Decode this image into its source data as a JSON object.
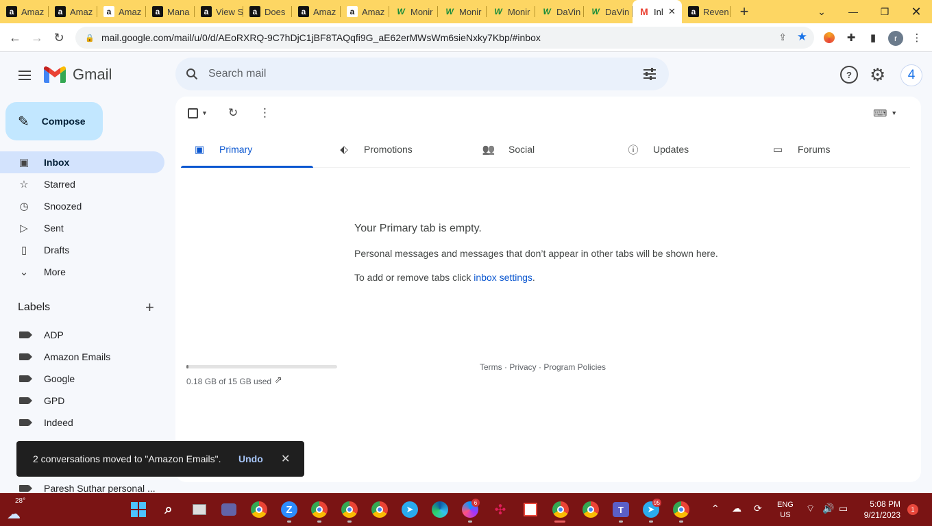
{
  "browser": {
    "tabs": [
      {
        "title": "Amaz",
        "icon": "amazon-icon"
      },
      {
        "title": "Amaz",
        "icon": "amazon-icon"
      },
      {
        "title": "Amaz",
        "icon": "amazon-icon"
      },
      {
        "title": "Mana",
        "icon": "amazon-icon"
      },
      {
        "title": "View S",
        "icon": "amazon-icon"
      },
      {
        "title": "Does",
        "icon": "amazon-icon"
      },
      {
        "title": "Amaz",
        "icon": "amazon-icon"
      },
      {
        "title": "Amaz",
        "icon": "amazon-icon"
      },
      {
        "title": "Monir",
        "icon": "monir-icon"
      },
      {
        "title": "Monir",
        "icon": "monir-icon"
      },
      {
        "title": "Monir",
        "icon": "monir-icon"
      },
      {
        "title": "DaVin",
        "icon": "davinci-icon"
      },
      {
        "title": "DaVin",
        "icon": "davinci-icon"
      },
      {
        "title": "Inl",
        "icon": "gmail-icon"
      },
      {
        "title": "Reven",
        "icon": "amazon-icon"
      }
    ],
    "url": "mail.google.com/mail/u/0/d/AEoRXRQ-9C7hDjC1jBF8TAQqfi9G_aE62erMWsWm6sieNxky7Kbp/#inbox",
    "profile_initial": "r"
  },
  "gmail": {
    "brand": "Gmail",
    "search_placeholder": "Search mail",
    "account_initial": "4",
    "compose_label": "Compose",
    "nav": [
      {
        "label": "Inbox",
        "icon": "inbox-icon"
      },
      {
        "label": "Starred",
        "icon": "star-icon"
      },
      {
        "label": "Snoozed",
        "icon": "clock-icon"
      },
      {
        "label": "Sent",
        "icon": "send-icon"
      },
      {
        "label": "Drafts",
        "icon": "draft-icon"
      },
      {
        "label": "More",
        "icon": "chevron-down-icon"
      }
    ],
    "labels_title": "Labels",
    "labels": [
      "ADP",
      "Amazon Emails",
      "Google",
      "GPD",
      "Indeed",
      "Paresh Suthar personal ..."
    ],
    "category_tabs": [
      {
        "label": "Primary",
        "icon": "inbox-icon"
      },
      {
        "label": "Promotions",
        "icon": "tag-icon"
      },
      {
        "label": "Social",
        "icon": "people-icon"
      },
      {
        "label": "Updates",
        "icon": "info-icon"
      },
      {
        "label": "Forums",
        "icon": "forum-icon"
      }
    ],
    "empty_title": "Your Primary tab is empty.",
    "empty_sub": "Personal messages and messages that don’t appear in other tabs will be shown here.",
    "empty_link_prefix": "To add or remove tabs click ",
    "empty_link_text": "inbox settings",
    "empty_link_suffix": ".",
    "storage_text": "0.18 GB of 15 GB used",
    "storage_fraction": 0.012,
    "footer": "Terms · Privacy · Program Policies",
    "snackbar": {
      "message": "2 conversations moved to \"Amazon Emails\".",
      "action": "Undo"
    }
  },
  "taskbar": {
    "weather_temp": "28°",
    "lang_line1": "ENG",
    "lang_line2": "US",
    "time": "5:08 PM",
    "date": "9/21/2023",
    "notifications": "1",
    "messenger_badge": "6",
    "telegram_badge": "95",
    "colors": {
      "bar": "#7a1414"
    }
  }
}
